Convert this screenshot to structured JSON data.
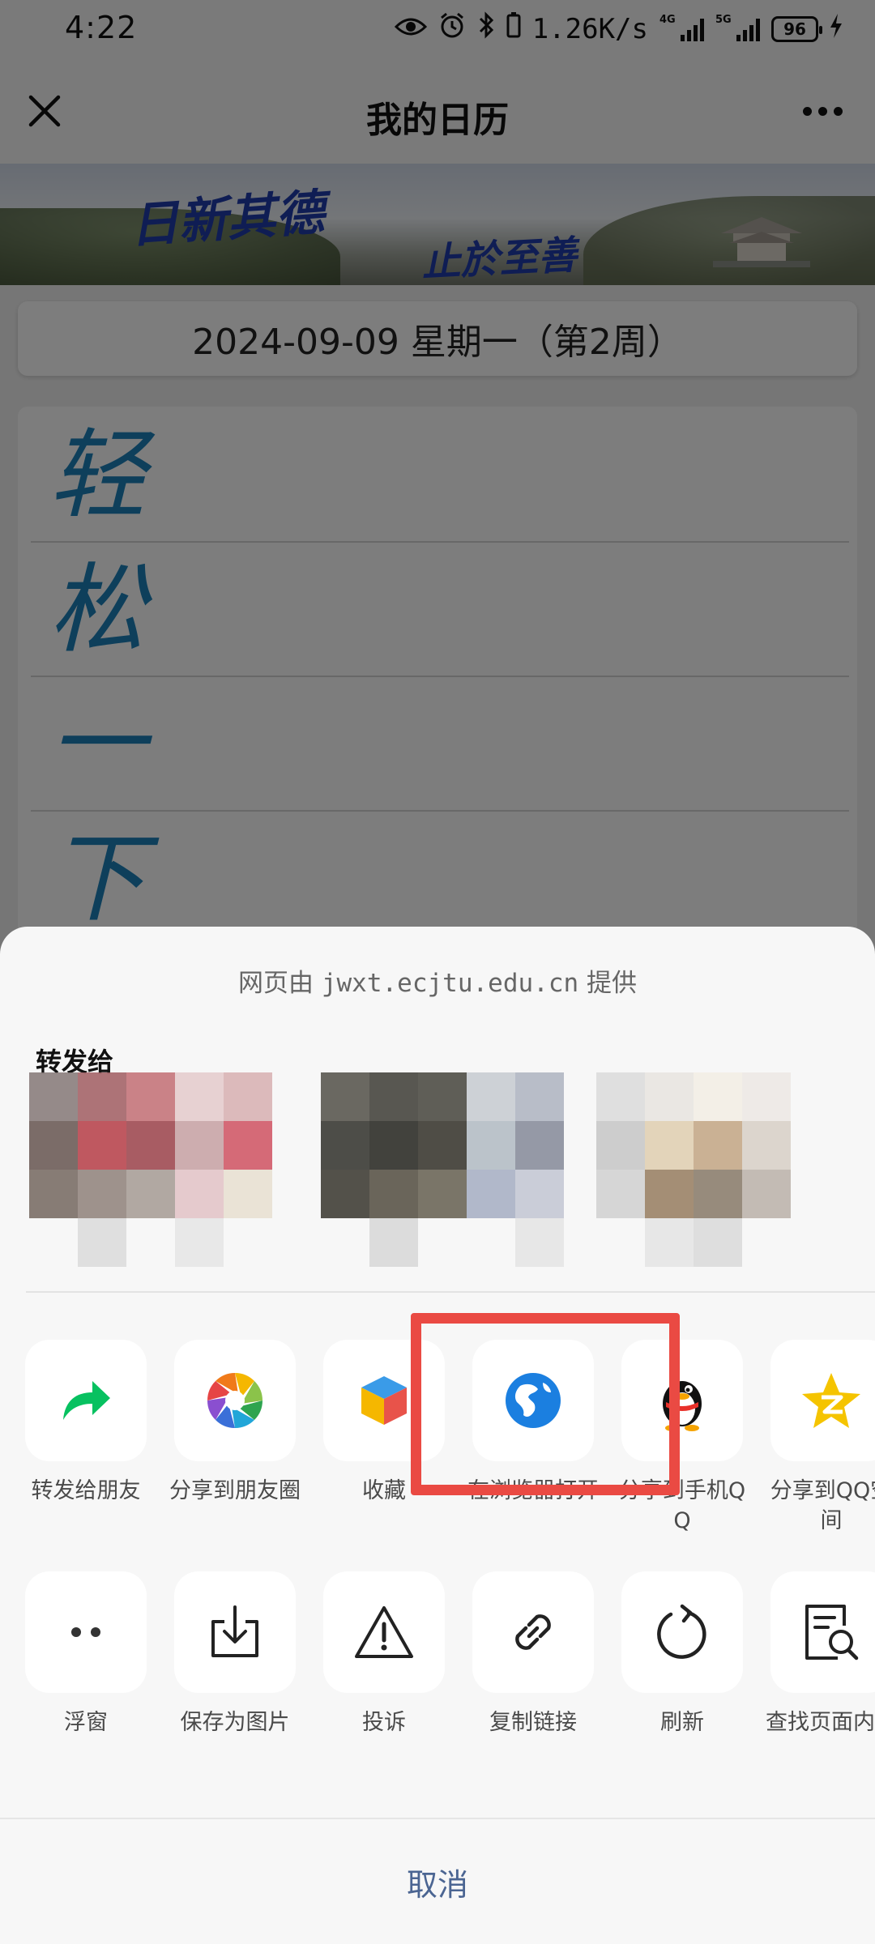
{
  "status_bar": {
    "time": "4:22",
    "speed": "1.26K/s",
    "battery": "96",
    "net_tag_1": "4G",
    "net_tag_2": "5G"
  },
  "header": {
    "title": "我的日历"
  },
  "banner": {
    "calligraphy_left": "日新其德",
    "calligraphy_right": "止於至善"
  },
  "date_bar": {
    "text": "2024-09-09  星期一（第2周）"
  },
  "schedule": {
    "rows": [
      "轻",
      "松",
      "一",
      "下"
    ]
  },
  "share_sheet": {
    "provider_prefix": "网页由",
    "provider_domain": "jwxt.ecjtu.edu.cn",
    "provider_suffix": "提供",
    "forward_label": "转发给",
    "actions_row1": [
      {
        "label": "转发给朋友",
        "icon": "forward-arrow-icon"
      },
      {
        "label": "分享到朋友圈",
        "icon": "moments-icon"
      },
      {
        "label": "收藏",
        "icon": "favorites-cube-icon"
      },
      {
        "label": "在浏览器打开",
        "icon": "browser-globe-icon"
      },
      {
        "label": "分享到手机QQ",
        "icon": "qq-penguin-icon"
      },
      {
        "label": "分享到QQ空间",
        "icon": "qzone-star-icon"
      }
    ],
    "actions_row2": [
      {
        "label": "浮窗",
        "icon": "floating-window-icon"
      },
      {
        "label": "保存为图片",
        "icon": "save-image-icon"
      },
      {
        "label": "投诉",
        "icon": "warning-icon"
      },
      {
        "label": "复制链接",
        "icon": "link-icon"
      },
      {
        "label": "刷新",
        "icon": "refresh-icon"
      },
      {
        "label": "查找页面内容",
        "icon": "search-page-icon"
      }
    ],
    "cancel": "取消",
    "highlight_color": "#ea4a43"
  }
}
